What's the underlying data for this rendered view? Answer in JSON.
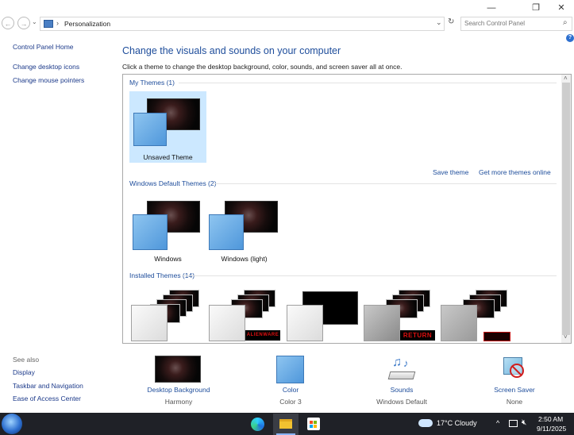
{
  "window": {
    "minimize_glyph": "—",
    "restore_glyph": "❐",
    "close_glyph": "✕"
  },
  "address": {
    "back_glyph": "←",
    "forward_glyph": "→",
    "recent_glyph": "⌄",
    "breadcrumb_sep": "›",
    "path": "Personalization",
    "dropdown_glyph": "⌄",
    "refresh_glyph": "↻",
    "search_placeholder": "Search Control Panel",
    "search_glyph": "⌕",
    "help_glyph": "?"
  },
  "sidebar": {
    "home": "Control Panel Home",
    "links": [
      "Change desktop icons",
      "Change mouse pointers"
    ],
    "see_also_title": "See also",
    "see_also": [
      "Display",
      "Taskbar and Navigation",
      "Ease of Access Center"
    ]
  },
  "main": {
    "title": "Change the visuals and sounds on your computer",
    "subtitle": "Click a theme to change the desktop background, color, sounds, and screen saver all at once."
  },
  "themes": {
    "my_header": "My Themes (1)",
    "my_items": [
      {
        "name": "Unsaved Theme"
      }
    ],
    "save_theme": "Save theme",
    "get_more": "Get more themes online",
    "default_header": "Windows Default Themes (2)",
    "default_items": [
      {
        "name": "Windows"
      },
      {
        "name": "Windows (light)"
      }
    ],
    "installed_header": "Installed Themes (14)",
    "installed_labels": [
      "ALIENWARE",
      "RETURN"
    ]
  },
  "bottom": [
    {
      "label": "Desktop Background",
      "value": "Harmony"
    },
    {
      "label": "Color",
      "value": "Color 3"
    },
    {
      "label": "Sounds",
      "value": "Windows Default"
    },
    {
      "label": "Screen Saver",
      "value": "None"
    }
  ],
  "taskbar": {
    "weather": "17°C  Cloudy",
    "chevron_glyph": "^",
    "time": "2:50 AM",
    "date": "9/11/2025"
  },
  "colors": {
    "link": "#1e4d9b",
    "accent_blue": "#4f97db",
    "selected_bg": "#cce8ff",
    "taskbar": "#1f2127"
  }
}
